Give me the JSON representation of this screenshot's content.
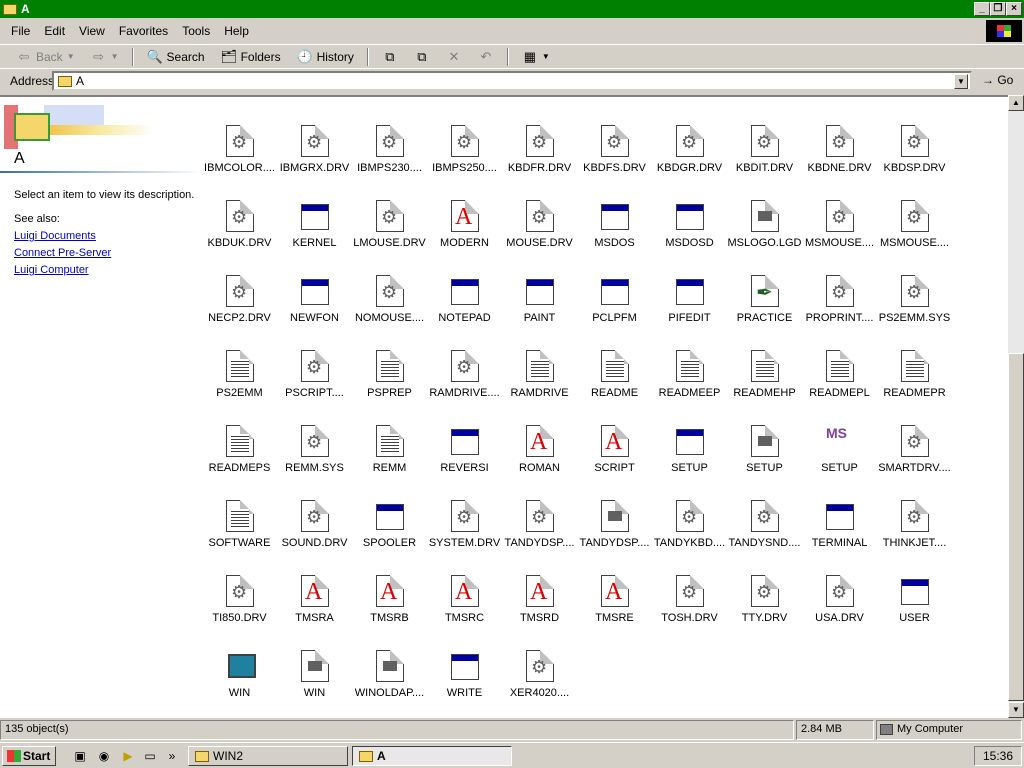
{
  "window": {
    "title": "A"
  },
  "menu": [
    "File",
    "Edit",
    "View",
    "Favorites",
    "Tools",
    "Help"
  ],
  "toolbar": {
    "back": "Back",
    "search": "Search",
    "folders": "Folders",
    "history": "History"
  },
  "address": {
    "label": "Address",
    "value": "A",
    "go": "Go"
  },
  "left_pane": {
    "folder_name": "A",
    "description": "Select an item to view its description.",
    "see_also": "See also:",
    "links": [
      "Luigi Documents",
      "Connect Pre-Server",
      "Luigi Computer"
    ]
  },
  "files": [
    {
      "name": "IBMCOLOR....",
      "icon": "gear-icon"
    },
    {
      "name": "IBMGRX.DRV",
      "icon": "gear-icon"
    },
    {
      "name": "IBMPS230....",
      "icon": "gear-icon"
    },
    {
      "name": "IBMPS250....",
      "icon": "gear-icon"
    },
    {
      "name": "KBDFR.DRV",
      "icon": "gear-icon"
    },
    {
      "name": "KBDFS.DRV",
      "icon": "gear-icon"
    },
    {
      "name": "KBDGR.DRV",
      "icon": "gear-icon"
    },
    {
      "name": "KBDIT.DRV",
      "icon": "gear-icon"
    },
    {
      "name": "KBDNE.DRV",
      "icon": "gear-icon"
    },
    {
      "name": "KBDSP.DRV",
      "icon": "gear-icon"
    },
    {
      "name": "KBDUK.DRV",
      "icon": "gear-icon"
    },
    {
      "name": "KERNEL",
      "icon": "app-icon"
    },
    {
      "name": "LMOUSE.DRV",
      "icon": "gear-icon"
    },
    {
      "name": "MODERN",
      "icon": "font-icon"
    },
    {
      "name": "MOUSE.DRV",
      "icon": "gear-icon"
    },
    {
      "name": "MSDOS",
      "icon": "app-icon"
    },
    {
      "name": "MSDOSD",
      "icon": "app-icon"
    },
    {
      "name": "MSLOGO.LGD",
      "icon": "logo-icon"
    },
    {
      "name": "MSMOUSE....",
      "icon": "gear-icon"
    },
    {
      "name": "MSMOUSE....",
      "icon": "gear-icon"
    },
    {
      "name": "NECP2.DRV",
      "icon": "gear-icon"
    },
    {
      "name": "NEWFON",
      "icon": "app-icon"
    },
    {
      "name": "NOMOUSE....",
      "icon": "gear-icon"
    },
    {
      "name": "NOTEPAD",
      "icon": "app-icon"
    },
    {
      "name": "PAINT",
      "icon": "app-icon"
    },
    {
      "name": "PCLPFM",
      "icon": "app-icon"
    },
    {
      "name": "PIFEDIT",
      "icon": "app-icon"
    },
    {
      "name": "PRACTICE",
      "icon": "pen-icon"
    },
    {
      "name": "PROPRINT....",
      "icon": "gear-icon"
    },
    {
      "name": "PS2EMM.SYS",
      "icon": "gear-icon"
    },
    {
      "name": "PS2EMM",
      "icon": "text-icon"
    },
    {
      "name": "PSCRIPT....",
      "icon": "gear-icon"
    },
    {
      "name": "PSPREP",
      "icon": "text-icon"
    },
    {
      "name": "RAMDRIVE....",
      "icon": "gear-icon"
    },
    {
      "name": "RAMDRIVE",
      "icon": "text-icon"
    },
    {
      "name": "README",
      "icon": "text-icon"
    },
    {
      "name": "READMEEP",
      "icon": "text-icon"
    },
    {
      "name": "READMEHP",
      "icon": "text-icon"
    },
    {
      "name": "READMEPL",
      "icon": "text-icon"
    },
    {
      "name": "READMEPR",
      "icon": "text-icon"
    },
    {
      "name": "READMEPS",
      "icon": "text-icon"
    },
    {
      "name": "REMM.SYS",
      "icon": "gear-icon"
    },
    {
      "name": "REMM",
      "icon": "text-icon"
    },
    {
      "name": "REVERSI",
      "icon": "app-icon"
    },
    {
      "name": "ROMAN",
      "icon": "font-icon"
    },
    {
      "name": "SCRIPT",
      "icon": "font-icon"
    },
    {
      "name": "SETUP",
      "icon": "app-icon"
    },
    {
      "name": "SETUP",
      "icon": "logo-icon"
    },
    {
      "name": "SETUP",
      "icon": "ms-setup-icon"
    },
    {
      "name": "SMARTDRV....",
      "icon": "gear-icon"
    },
    {
      "name": "SOFTWARE",
      "icon": "text-icon"
    },
    {
      "name": "SOUND.DRV",
      "icon": "gear-icon"
    },
    {
      "name": "SPOOLER",
      "icon": "app-icon"
    },
    {
      "name": "SYSTEM.DRV",
      "icon": "gear-icon"
    },
    {
      "name": "TANDYDSP....",
      "icon": "gear-icon"
    },
    {
      "name": "TANDYDSP....",
      "icon": "logo-icon"
    },
    {
      "name": "TANDYKBD....",
      "icon": "gear-icon"
    },
    {
      "name": "TANDYSND....",
      "icon": "gear-icon"
    },
    {
      "name": "TERMINAL",
      "icon": "app-icon"
    },
    {
      "name": "THINKJET....",
      "icon": "gear-icon"
    },
    {
      "name": "TI850.DRV",
      "icon": "gear-icon"
    },
    {
      "name": "TMSRA",
      "icon": "font-icon"
    },
    {
      "name": "TMSRB",
      "icon": "font-icon"
    },
    {
      "name": "TMSRC",
      "icon": "font-icon"
    },
    {
      "name": "TMSRD",
      "icon": "font-icon"
    },
    {
      "name": "TMSRE",
      "icon": "font-icon"
    },
    {
      "name": "TOSH.DRV",
      "icon": "gear-icon"
    },
    {
      "name": "TTY.DRV",
      "icon": "gear-icon"
    },
    {
      "name": "USA.DRV",
      "icon": "gear-icon"
    },
    {
      "name": "USER",
      "icon": "app-icon"
    },
    {
      "name": "WIN",
      "icon": "computer-icon"
    },
    {
      "name": "WIN",
      "icon": "logo-icon"
    },
    {
      "name": "WINOLDAP....",
      "icon": "logo-icon"
    },
    {
      "name": "WRITE",
      "icon": "app-icon"
    },
    {
      "name": "XER4020....",
      "icon": "gear-icon"
    }
  ],
  "status": {
    "objects": "135 object(s)",
    "size": "2.84 MB",
    "zone": "My Computer"
  },
  "taskbar": {
    "start": "Start",
    "tasks": [
      "WIN2",
      "A"
    ],
    "clock": "15:36"
  }
}
